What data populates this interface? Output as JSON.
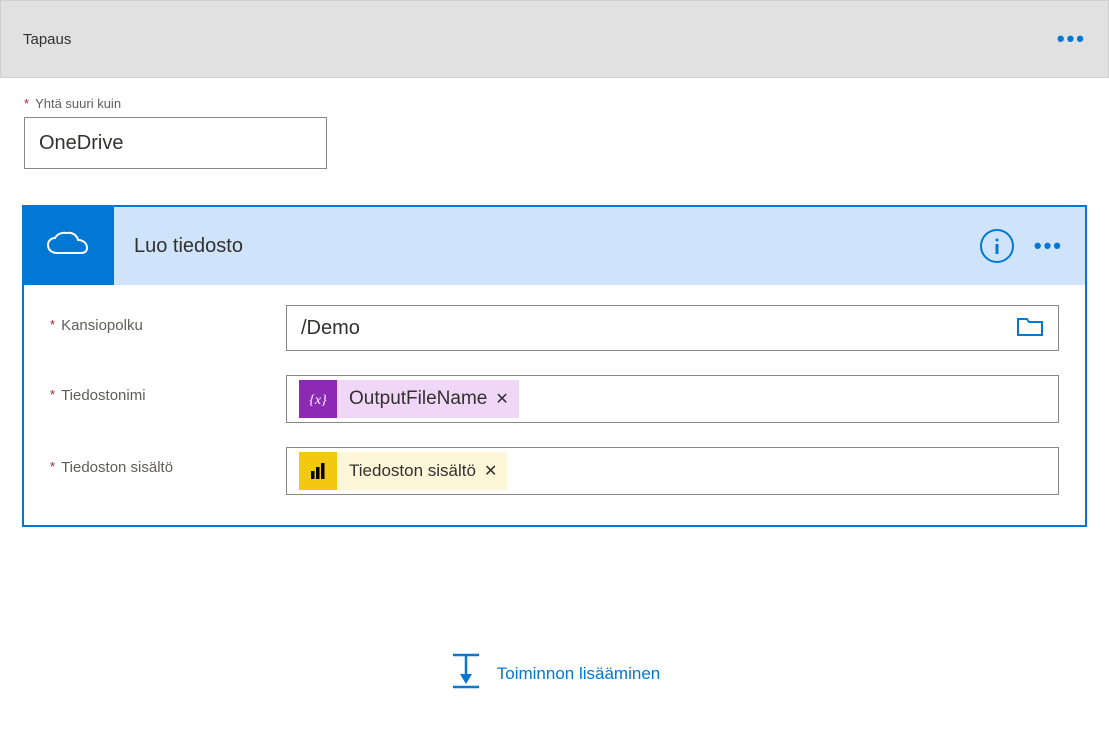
{
  "caseHeader": {
    "title": "Tapaus"
  },
  "equals": {
    "label": "Yhtä suuri kuin",
    "value": "OneDrive"
  },
  "action": {
    "title": "Luo tiedosto",
    "fields": {
      "folderPath": {
        "label": "Kansiopolku",
        "value": "/Demo"
      },
      "fileName": {
        "label": "Tiedostonimi",
        "tokenLabel": "OutputFileName"
      },
      "fileContent": {
        "label": "Tiedoston sisältö",
        "tokenLabel": "Tiedoston sisältö"
      }
    }
  },
  "addAction": {
    "label": "Toiminnon lisääminen"
  }
}
